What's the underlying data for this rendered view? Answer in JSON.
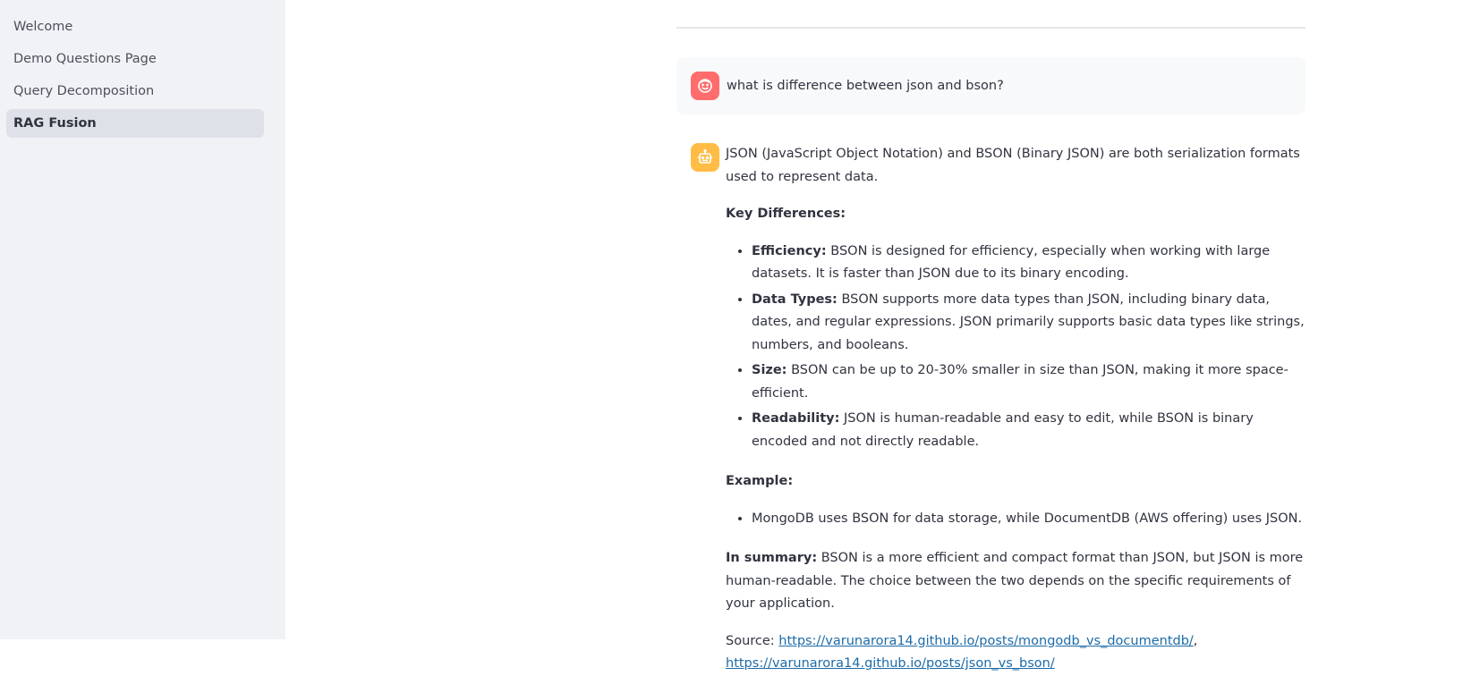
{
  "sidebar": {
    "items": [
      {
        "label": "Welcome",
        "active": false
      },
      {
        "label": "Demo Questions Page",
        "active": false
      },
      {
        "label": "Query Decomposition",
        "active": false
      },
      {
        "label": "RAG Fusion",
        "active": true
      }
    ]
  },
  "chat": {
    "user_message": "what is difference between json and bson?",
    "assistant": {
      "intro": "JSON (JavaScript Object Notation) and BSON (Binary JSON) are both serialization formats used to represent data.",
      "key_differences_heading": "Key Differences:",
      "differences": [
        {
          "term": "Efficiency:",
          "text": " BSON is designed for efficiency, especially when working with large datasets. It is faster than JSON due to its binary encoding."
        },
        {
          "term": "Data Types:",
          "text": " BSON supports more data types than JSON, including binary data, dates, and regular expressions. JSON primarily supports basic data types like strings, numbers, and booleans."
        },
        {
          "term": "Size:",
          "text": " BSON can be up to 20-30% smaller in size than JSON, making it more space-efficient."
        },
        {
          "term": "Readability:",
          "text": " JSON is human-readable and easy to edit, while BSON is binary encoded and not directly readable."
        }
      ],
      "example_heading": "Example:",
      "example_item": "MongoDB uses BSON for data storage, while DocumentDB (AWS offering) uses JSON.",
      "summary_term": "In summary:",
      "summary_text": " BSON is a more efficient and compact format than JSON, but JSON is more human-readable. The choice between the two depends on the specific requirements of your application.",
      "source_label": "Source: ",
      "source_links": [
        "https://varunarora14.github.io/posts/mongodb_vs_documentdb/",
        "https://varunarora14.github.io/posts/json_vs_bson/"
      ],
      "source_separator": ","
    }
  },
  "colors": {
    "sidebar_bg": "#f0f2f6",
    "user_avatar": "#ff6c6c",
    "bot_avatar": "#ffbd45",
    "link": "#1c6ba8"
  },
  "icons": {
    "user_avatar": "smiley-face-icon",
    "bot_avatar": "robot-icon"
  }
}
